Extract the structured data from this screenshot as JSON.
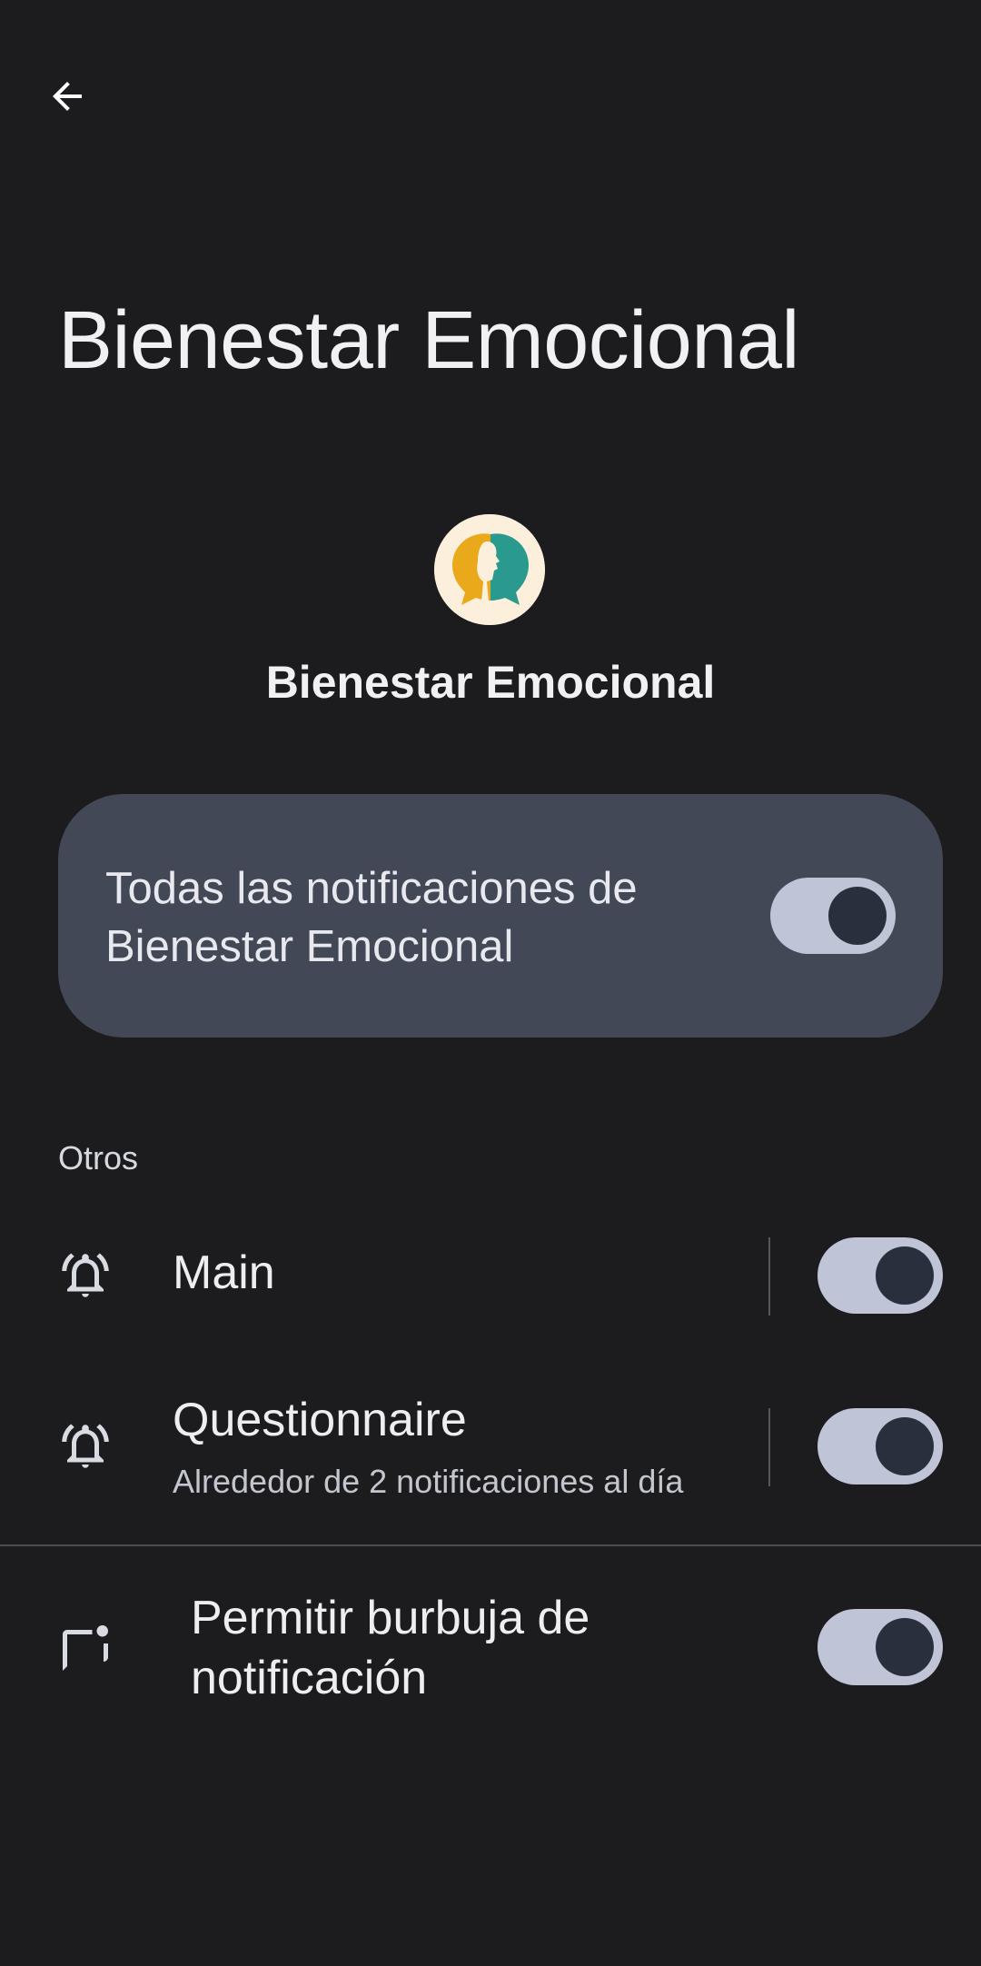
{
  "header": {
    "back_icon": "arrow-back-icon",
    "title": "Bienestar Emocional"
  },
  "app": {
    "icon": "app-logo-icon",
    "name": "Bienestar Emocional"
  },
  "master_toggle": {
    "label": "Todas las notificaciones de Bienestar Emocional",
    "enabled": true
  },
  "section": {
    "header": "Otros"
  },
  "channels": [
    {
      "icon": "bell-alarm-icon",
      "title": "Main",
      "subtitle": "",
      "enabled": true
    },
    {
      "icon": "bell-alarm-icon",
      "title": "Questionnaire",
      "subtitle": "Alrededor de 2 notificaciones al día",
      "enabled": true
    }
  ],
  "bubble": {
    "icon": "chat-bubble-dot-icon",
    "title": "Permitir burbuja de notificación",
    "enabled": true
  },
  "colors": {
    "background": "#1c1c1e",
    "card": "#424856",
    "toggle_track": "#bfc5d6",
    "toggle_knob": "#2a2f3d"
  }
}
